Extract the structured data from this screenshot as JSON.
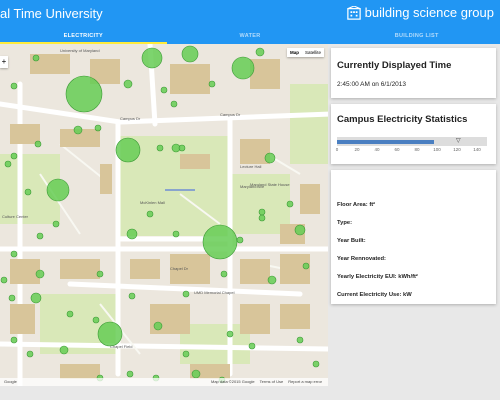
{
  "app": {
    "title": "al Time University",
    "brand": "building science group"
  },
  "tabs": [
    {
      "label": "ELECTRICITY",
      "active": true
    },
    {
      "label": "WATER",
      "active": false
    },
    {
      "label": "BUILDING LIST",
      "active": false
    }
  ],
  "map": {
    "toggle": {
      "map": "Map",
      "satellite": "Satellite"
    },
    "zoom": "+",
    "labels": [
      "Campus Dr",
      "Campus Dr",
      "Maryland Ave",
      "McKinlen Mall",
      "Chapel Dr",
      "UMD Memorial Chapel",
      "Chapel Field",
      "Maryland State House",
      "University of Maryland",
      "Culture Center",
      "Lecture Hall"
    ],
    "footer": {
      "left": "Google",
      "map_data": "Map data ©2015 Google",
      "terms": "Terms of Use",
      "report": "Report a map error"
    },
    "colors": {
      "circle": "#66cc55",
      "circle_stroke": "#3b9a35",
      "road": "#ffffff",
      "grass": "#d9e8b8",
      "building": "#d8c59a"
    }
  },
  "time_card": {
    "title": "Currently Displayed Time",
    "time": "2:45:00 AM on 6/1/2013"
  },
  "stats_card": {
    "title": "Campus Electricity Statistics",
    "gauge_value": 97,
    "gauge_max": 150,
    "marker_value": 122,
    "marker_symbol": "▽",
    "ticks": [
      "0",
      "20",
      "40",
      "60",
      "80",
      "100",
      "120",
      "140"
    ]
  },
  "building_info": {
    "floor_area": "Floor Area: ft²",
    "type": "Type:",
    "year_built": "Year Built:",
    "year_renovated": "Year Rennovated:",
    "yearly_eui": "Yearly Electricity EUI: kWh/ft²",
    "current_use": "Current Electricity Use: kW"
  }
}
